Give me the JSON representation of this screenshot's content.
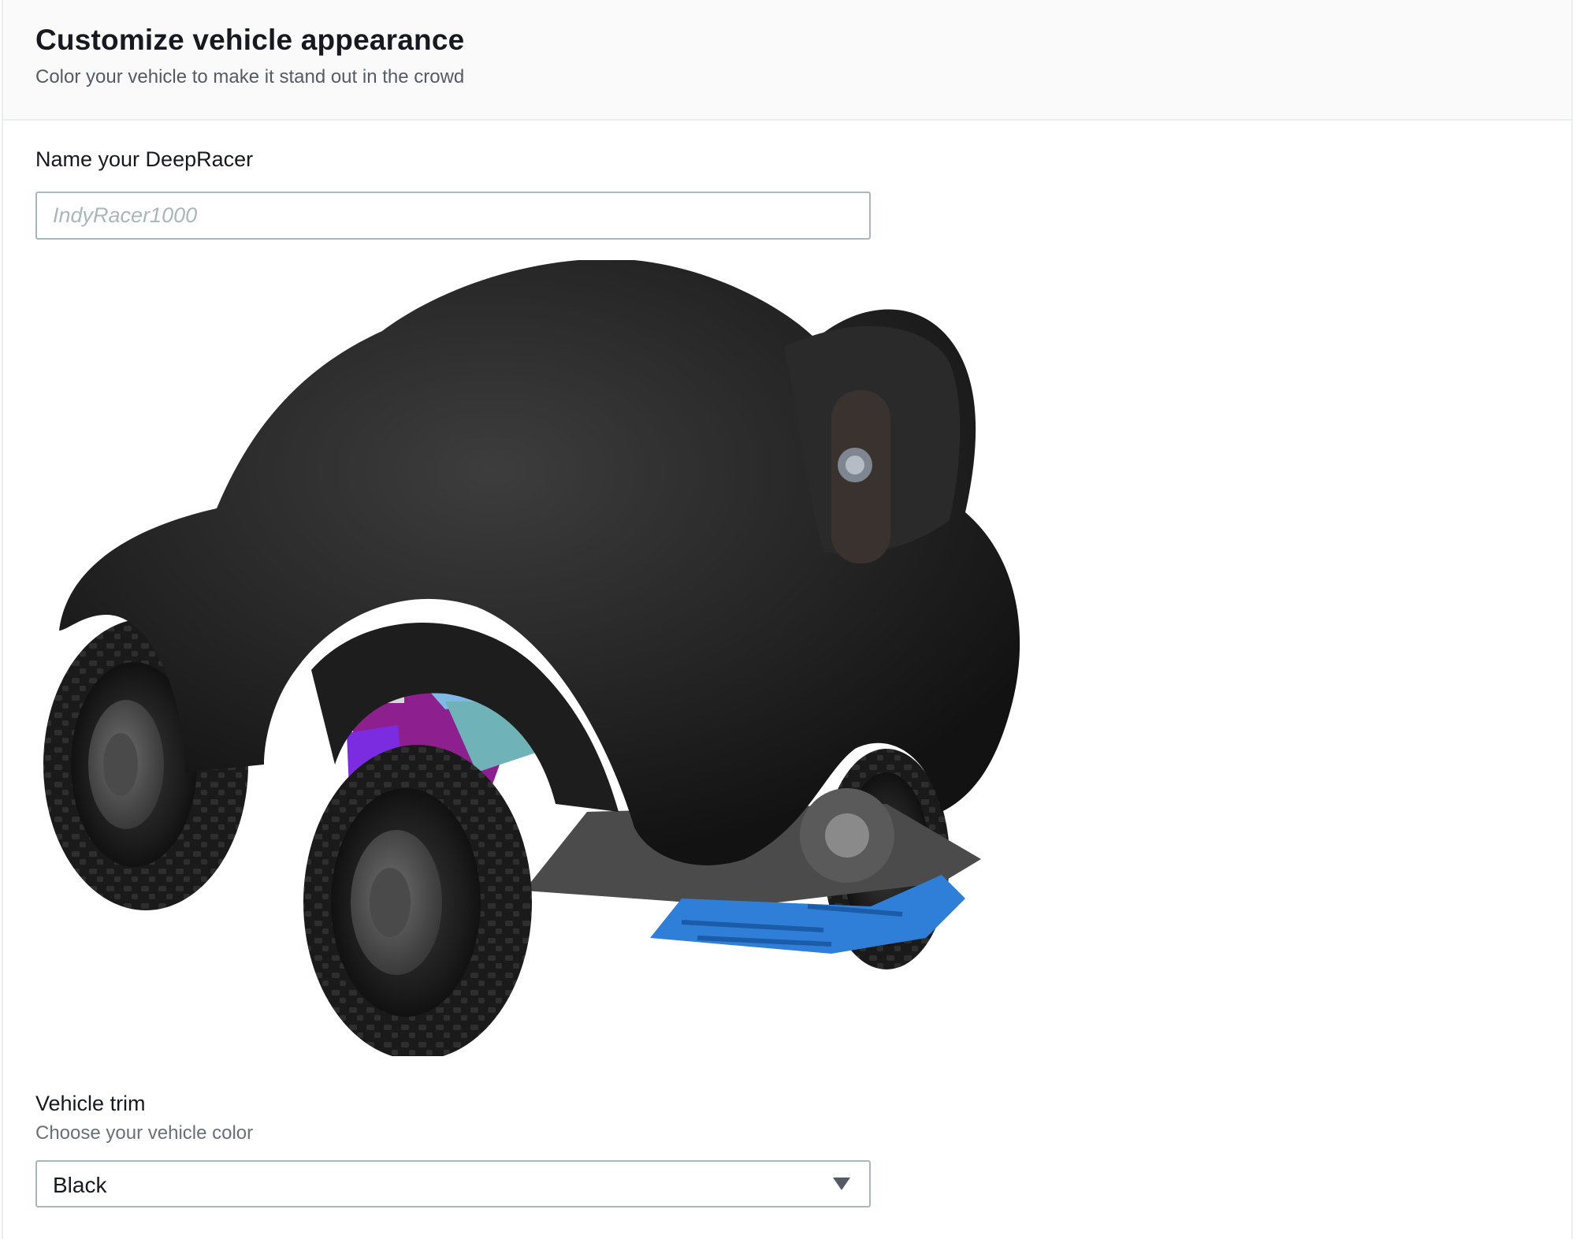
{
  "header": {
    "title": "Customize vehicle appearance",
    "subtitle": "Color your vehicle to make it stand out in the crowd"
  },
  "name_field": {
    "label": "Name your DeepRacer",
    "placeholder": "IndyRacer1000",
    "value": ""
  },
  "vehicle_preview": {
    "description_icon": "deepracer-3d-model",
    "shell_color": "#1f1f1f",
    "chassis_accent_color": "#2f7fd9"
  },
  "trim_field": {
    "label": "Vehicle trim",
    "description": "Choose your vehicle color",
    "selected": "Black",
    "caret_icon": "caret-down-icon"
  },
  "colors": {
    "header_bg": "#fafafa",
    "border": "#aab7b8",
    "text": "#16191f",
    "muted": "#687078"
  }
}
